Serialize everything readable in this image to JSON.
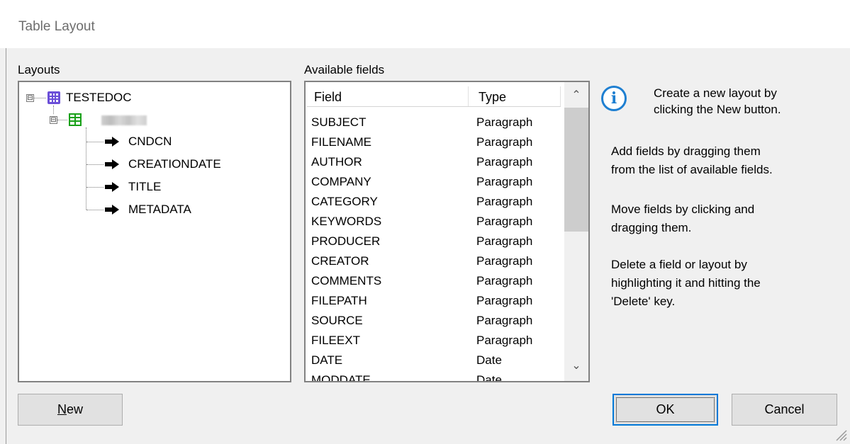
{
  "window": {
    "title": "Table Layout"
  },
  "layouts": {
    "label": "Layouts",
    "tree": {
      "root": {
        "label": "TESTEDOC",
        "expander": "⊟"
      },
      "layout": {
        "label": "",
        "expander": "⊟"
      },
      "fields": [
        {
          "label": "CNDCN"
        },
        {
          "label": "CREATIONDATE"
        },
        {
          "label": "TITLE"
        },
        {
          "label": "METADATA"
        }
      ]
    }
  },
  "available_fields": {
    "label": "Available fields",
    "columns": {
      "field": "Field",
      "type": "Type"
    },
    "rows": [
      {
        "field": "SUBJECT",
        "type": "Paragraph"
      },
      {
        "field": "FILENAME",
        "type": "Paragraph"
      },
      {
        "field": "AUTHOR",
        "type": "Paragraph"
      },
      {
        "field": "COMPANY",
        "type": "Paragraph"
      },
      {
        "field": "CATEGORY",
        "type": "Paragraph"
      },
      {
        "field": "KEYWORDS",
        "type": "Paragraph"
      },
      {
        "field": "PRODUCER",
        "type": "Paragraph"
      },
      {
        "field": "CREATOR",
        "type": "Paragraph"
      },
      {
        "field": "COMMENTS",
        "type": "Paragraph"
      },
      {
        "field": "FILEPATH",
        "type": "Paragraph"
      },
      {
        "field": "SOURCE",
        "type": "Paragraph"
      },
      {
        "field": "FILEEXT",
        "type": "Paragraph"
      },
      {
        "field": "DATE",
        "type": "Date"
      },
      {
        "field": "MODDATE",
        "type": "Date"
      }
    ],
    "scroll": {
      "up": "⌃",
      "down": "⌄"
    }
  },
  "info": {
    "icon": "info-icon",
    "lines_1": [
      "Create a new layout by",
      "clicking the New button."
    ],
    "lines_2": [
      "Add fields by dragging them",
      "from the list of available fields."
    ],
    "lines_3": [
      "Move fields by clicking and",
      "dragging them."
    ],
    "lines_4": [
      "Delete a field or layout by",
      "highlighting it and hitting the",
      "'Delete' key."
    ]
  },
  "buttons": {
    "new": {
      "accel": "N",
      "rest": "ew"
    },
    "ok": "OK",
    "cancel": "Cancel"
  },
  "colors": {
    "accent": "#0078d7",
    "info": "#1e7fd1",
    "db_icon": "#6b4fd8",
    "table_icon": "#18a018"
  }
}
